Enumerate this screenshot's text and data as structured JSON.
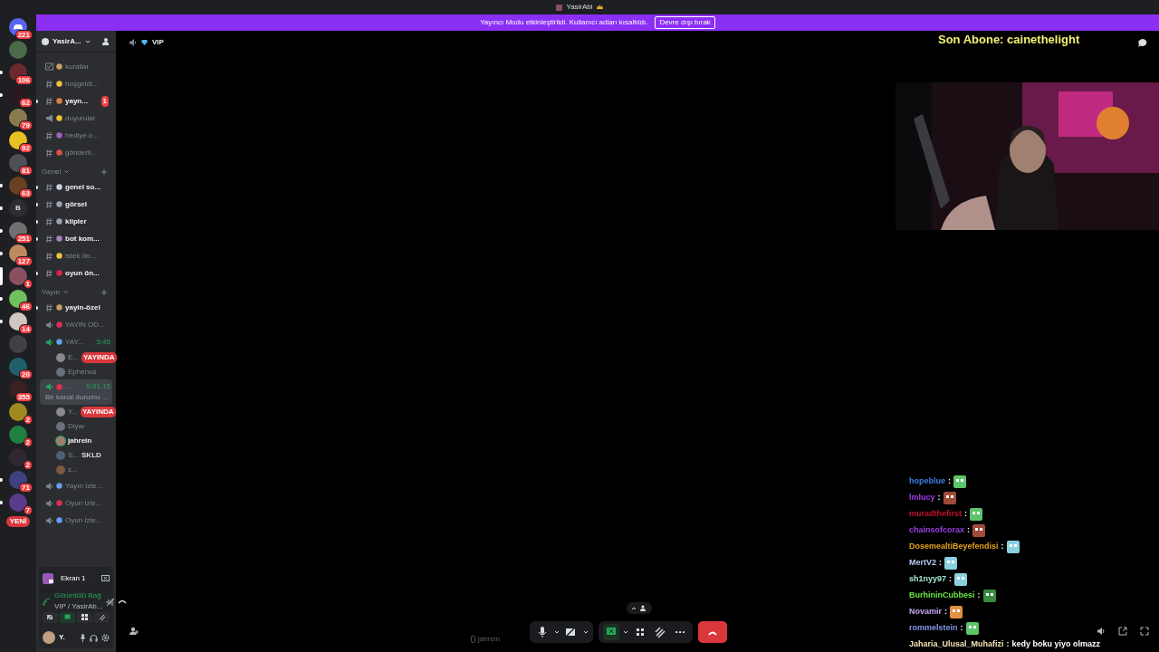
{
  "window": {
    "title": "YasirAbi"
  },
  "banner": {
    "message": "Yayıncı Modu etkinleştirildi. Kullanıcı adları kısaltıldı.",
    "button": "Devre dışı bırak"
  },
  "servers": [
    {
      "kind": "home",
      "badge": "221",
      "unread": false,
      "selected": false
    },
    {
      "kind": "icon",
      "color": "#4a6a4a",
      "unread": false,
      "selected": false
    },
    {
      "kind": "icon",
      "color": "#6a2a30",
      "badge": "106",
      "unread": true,
      "selected": false
    },
    {
      "kind": "icon",
      "color": "#2a1a20",
      "badge": "62",
      "unread": true,
      "selected": false
    },
    {
      "kind": "icon",
      "color": "#8a7a50",
      "badge": "79",
      "unread": false,
      "selected": false
    },
    {
      "kind": "icon",
      "color": "#e8c020",
      "badge": "92",
      "unread": false,
      "selected": false
    },
    {
      "kind": "icon",
      "color": "#505058",
      "badge": "81",
      "unread": false,
      "selected": false
    },
    {
      "kind": "icon",
      "color": "#6a4020",
      "badge": "63",
      "unread": true,
      "selected": false
    },
    {
      "kind": "letter",
      "letter": "B",
      "unread": true,
      "selected": false
    },
    {
      "kind": "icon",
      "color": "#707070",
      "badge": "251",
      "unread": true,
      "selected": false
    },
    {
      "kind": "icon",
      "color": "#c08a60",
      "badge": "127",
      "unread": true,
      "selected": false
    },
    {
      "kind": "icon",
      "color": "#8a5060",
      "badge": "1",
      "unread": false,
      "selected": true
    },
    {
      "kind": "icon",
      "color": "#70c060",
      "badge": "46",
      "unread": true,
      "selected": false
    },
    {
      "kind": "icon",
      "color": "#d0c8c0",
      "badge": "14",
      "unread": true,
      "selected": false
    },
    {
      "kind": "icon",
      "color": "#404048",
      "unread": false,
      "selected": false
    },
    {
      "kind": "icon",
      "color": "#20606a",
      "badge": "20",
      "unread": false,
      "selected": false
    },
    {
      "kind": "icon",
      "color": "#3a2020",
      "badge": "355",
      "unread": false,
      "selected": false
    },
    {
      "kind": "icon",
      "color": "#a08a20",
      "badge": "2",
      "unread": false,
      "selected": false
    },
    {
      "kind": "icon",
      "color": "#208040",
      "badge": "2",
      "unread": false,
      "selected": false
    },
    {
      "kind": "icon",
      "color": "#302830",
      "badge": "2",
      "unread": false,
      "selected": false
    },
    {
      "kind": "icon",
      "color": "#404080",
      "badge": "71",
      "unread": true,
      "selected": false
    },
    {
      "kind": "icon",
      "color": "#5a3a8a",
      "badge": "7",
      "unread": true,
      "selected": false
    }
  ],
  "new_pill": "YENİ",
  "server_header": {
    "name": "YasirA..."
  },
  "channels": [
    {
      "kind": "rules",
      "name": "kurallar",
      "unread": false
    },
    {
      "kind": "text",
      "name": "hoşgeldi...",
      "unread": false
    },
    {
      "kind": "text",
      "name": "yayn...",
      "unread": true,
      "badge": "1"
    },
    {
      "kind": "announce",
      "name": "duyurular",
      "unread": false
    },
    {
      "kind": "text",
      "name": "hediye o...",
      "unread": false
    },
    {
      "kind": "text",
      "name": "gönderil...",
      "unread": false
    },
    {
      "kind": "category",
      "name": "Genel"
    },
    {
      "kind": "text",
      "name": "genel so...",
      "unread": true
    },
    {
      "kind": "text",
      "name": "görsel",
      "unread": true
    },
    {
      "kind": "text",
      "name": "klipler",
      "unread": true
    },
    {
      "kind": "text",
      "name": "bot kom...",
      "unread": true
    },
    {
      "kind": "text",
      "name": "istek ön...",
      "unread": false
    },
    {
      "kind": "text",
      "name": "oyun ön...",
      "unread": true
    },
    {
      "kind": "category",
      "name": "Yayın"
    },
    {
      "kind": "text",
      "name": "yayin-özel",
      "unread": true
    },
    {
      "kind": "voice",
      "name": "YAYIN OD...",
      "active": false,
      "selected": false
    },
    {
      "kind": "voice",
      "name": "YAY...",
      "active": true,
      "selected": false,
      "timer": "5:45",
      "children": [
        {
          "name": "E...",
          "tag": "YAYINDA",
          "live": true,
          "speaking": false
        },
        {
          "name": "Ephenus",
          "speaking": false
        }
      ]
    },
    {
      "kind": "voice",
      "name": "...",
      "active": true,
      "selected": true,
      "timer": "5:01:15",
      "status": "Bir kanal durumu ...",
      "children": [
        {
          "name": "Y...",
          "tag": "YAYINDA",
          "live": true,
          "speaking": false
        },
        {
          "name": "Diyar",
          "speaking": false
        },
        {
          "name": "jahrein",
          "speaking": true
        },
        {
          "name": "S...",
          "tag": "SKLD",
          "live": false,
          "speaking": false
        },
        {
          "name": "s...",
          "speaking": false
        }
      ]
    },
    {
      "kind": "voice",
      "name": "Yayın İzle...",
      "active": false,
      "selected": false
    },
    {
      "kind": "voice",
      "name": "Oyun İzle...",
      "active": false,
      "selected": false
    },
    {
      "kind": "voice",
      "name": "Oyun İzle...",
      "active": false,
      "selected": false
    }
  ],
  "panel": {
    "stream": "Ekran 1",
    "connection": "Görüntülü Bağ",
    "location": "VIP / YasirAb...",
    "user": "Y."
  },
  "header": {
    "channel": "VIP"
  },
  "stream": {
    "subscriber": "Son Abone: cainethelight",
    "chat": [
      {
        "user": "hopeblue",
        "color": "#3f7ee6",
        "separator": ":",
        "kind": "emote"
      },
      {
        "user": "lmlucy",
        "color": "#a13ee6",
        "separator": ":",
        "kind": "emote"
      },
      {
        "user": "muradthefirst",
        "color": "#c3122f",
        "separator": ":",
        "kind": "emote"
      },
      {
        "user": "chainsofcorax",
        "color": "#9b3fe3",
        "separator": ":",
        "kind": "emote"
      },
      {
        "user": "DosemealtiBeyefendisi",
        "color": "#e3a11f",
        "separator": ":",
        "kind": "emote"
      },
      {
        "user": "MertV2",
        "color": "#b3cdf2",
        "separator": ":",
        "kind": "emote"
      },
      {
        "user": "sh1nyy97",
        "color": "#a3e6d6",
        "separator": ":",
        "kind": "emote"
      },
      {
        "user": "BurhininCubbesi",
        "color": "#66e63f",
        "separator": ":",
        "kind": "emote"
      },
      {
        "user": "Novamir",
        "color": "#c6a6f2",
        "separator": ":",
        "kind": "emote"
      },
      {
        "user": "rommelstein",
        "color": "#8596e6",
        "separator": ":",
        "kind": "emote"
      },
      {
        "user": "Jaharia_Ulusal_Muhafizi",
        "color": "#f2e3b3",
        "separator": ":",
        "kind": "text",
        "message": "kedy boku yiyo olmazz"
      }
    ]
  },
  "watcher": "jahrein"
}
